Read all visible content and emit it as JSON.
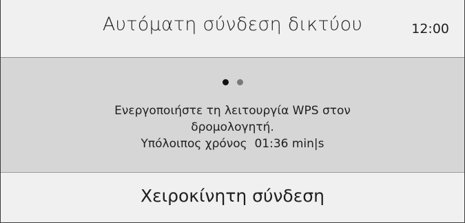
{
  "header": {
    "title": "Αυτόματη σύνδεση δικτύου",
    "clock": "12:00"
  },
  "panel": {
    "steps_total": 2,
    "steps_current": 1,
    "line1": "Ενεργοποιήστε τη λειτουργία WPS στον",
    "line2": "δρομολογητή.",
    "timer_label": "Υπόλοιπος χρόνος",
    "timer_value": "01:36 min|s"
  },
  "footer": {
    "manual_connection": "Χειροκίνητη σύνδεση"
  },
  "colors": {
    "background": "#f0f0f0",
    "panel": "#d6d6d6",
    "text": "#1e1e1e",
    "dot_active": "#111111",
    "dot_inactive": "#7a7a7a"
  }
}
